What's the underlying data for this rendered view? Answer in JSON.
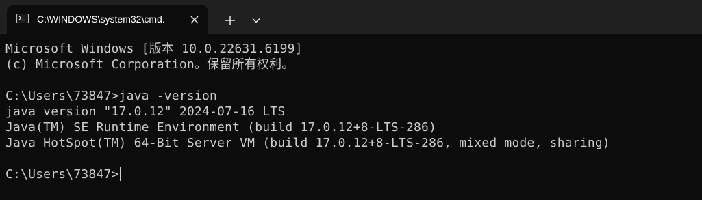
{
  "tab": {
    "title": "C:\\WINDOWS\\system32\\cmd.",
    "icon": "terminal-icon"
  },
  "tabbar": {
    "new_tab_icon": "plus-icon",
    "dropdown_icon": "chevron-down-icon",
    "close_icon": "close-icon"
  },
  "colors": {
    "background": "#0c0c0c",
    "tabbar": "#202020",
    "text": "#cccccc"
  },
  "terminal": {
    "lines": [
      "Microsoft Windows [版本 10.0.22631.6199]",
      "(c) Microsoft Corporation。保留所有权利。",
      "",
      "C:\\Users\\73847>java -version",
      "java version \"17.0.12\" 2024-07-16 LTS",
      "Java(TM) SE Runtime Environment (build 17.0.12+8-LTS-286)",
      "Java HotSpot(TM) 64-Bit Server VM (build 17.0.12+8-LTS-286, mixed mode, sharing)",
      "",
      "C:\\Users\\73847>"
    ]
  }
}
